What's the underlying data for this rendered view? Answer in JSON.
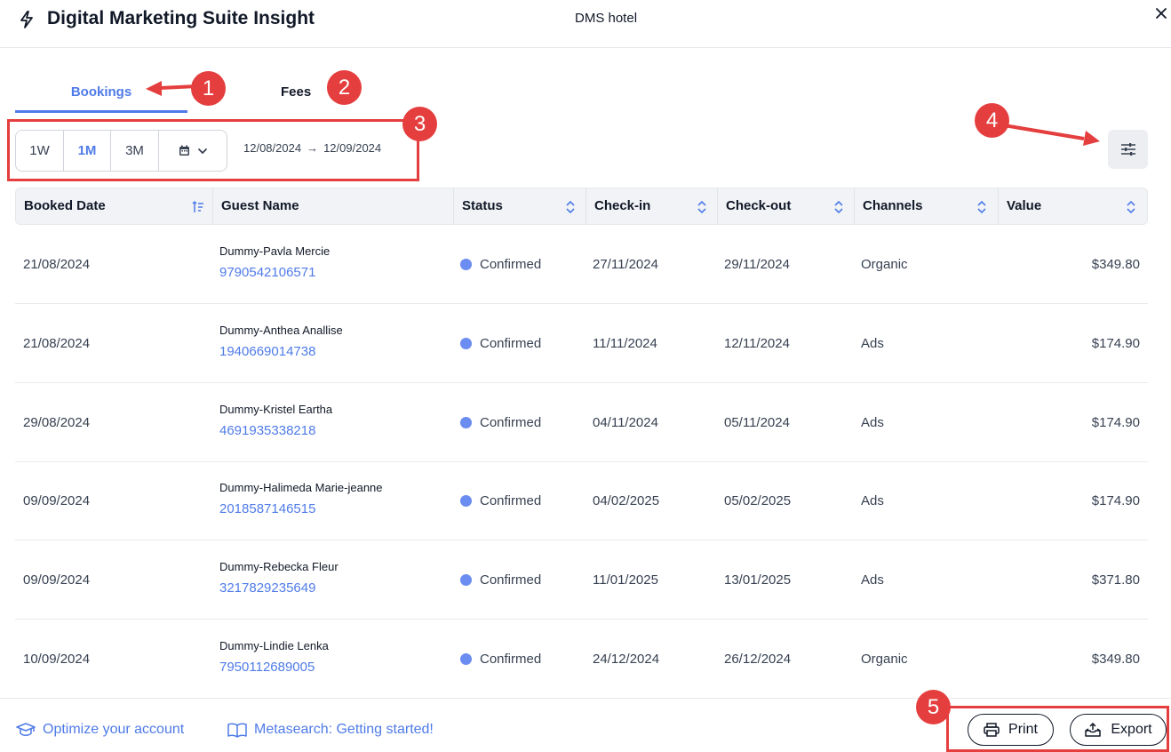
{
  "header": {
    "title": "Digital Marketing Suite Insight",
    "hotel": "DMS hotel"
  },
  "tabs": [
    {
      "label": "Bookings",
      "active": true
    },
    {
      "label": "Fees",
      "active": false
    }
  ],
  "period": {
    "options": [
      "1W",
      "1M",
      "3M"
    ],
    "selected": "1M",
    "date_from": "12/08/2024",
    "date_arrow": "→",
    "date_to": "12/09/2024"
  },
  "table": {
    "columns": [
      "Booked Date",
      "Guest Name",
      "Status",
      "Check-in",
      "Check-out",
      "Channels",
      "Value"
    ],
    "rows": [
      {
        "booked": "21/08/2024",
        "guest": "Dummy-Pavla Mercie",
        "id": "9790542106571",
        "status": "Confirmed",
        "checkin": "27/11/2024",
        "checkout": "29/11/2024",
        "channel": "Organic",
        "value": "$349.80"
      },
      {
        "booked": "21/08/2024",
        "guest": "Dummy-Anthea Anallise",
        "id": "1940669014738",
        "status": "Confirmed",
        "checkin": "11/11/2024",
        "checkout": "12/11/2024",
        "channel": "Ads",
        "value": "$174.90"
      },
      {
        "booked": "29/08/2024",
        "guest": "Dummy-Kristel Eartha",
        "id": "4691935338218",
        "status": "Confirmed",
        "checkin": "04/11/2024",
        "checkout": "05/11/2024",
        "channel": "Ads",
        "value": "$174.90"
      },
      {
        "booked": "09/09/2024",
        "guest": "Dummy-Halimeda Marie-jeanne",
        "id": "2018587146515",
        "status": "Confirmed",
        "checkin": "04/02/2025",
        "checkout": "05/02/2025",
        "channel": "Ads",
        "value": "$174.90"
      },
      {
        "booked": "09/09/2024",
        "guest": "Dummy-Rebecka Fleur",
        "id": "3217829235649",
        "status": "Confirmed",
        "checkin": "11/01/2025",
        "checkout": "13/01/2025",
        "channel": "Ads",
        "value": "$371.80"
      },
      {
        "booked": "10/09/2024",
        "guest": "Dummy-Lindie Lenka",
        "id": "7950112689005",
        "status": "Confirmed",
        "checkin": "24/12/2024",
        "checkout": "26/12/2024",
        "channel": "Organic",
        "value": "$349.80"
      }
    ]
  },
  "footer": {
    "links": [
      "Optimize your account",
      "Metasearch: Getting started!"
    ],
    "print_label": "Print",
    "export_label": "Export"
  },
  "annotations": [
    "1",
    "2",
    "3",
    "4",
    "5"
  ],
  "colors": {
    "accent": "#4f7be8",
    "status_dot": "#6b8cf0",
    "annotation": "#e53e3e"
  },
  "icons": {
    "header": [
      "bolt-icon",
      "close-icon"
    ],
    "toolbar": [
      "calendar-icon",
      "chevron-down-icon",
      "filter-sliders-icon"
    ],
    "footer": [
      "graduation-cap-icon",
      "book-icon",
      "printer-icon",
      "export-tray-icon"
    ]
  }
}
